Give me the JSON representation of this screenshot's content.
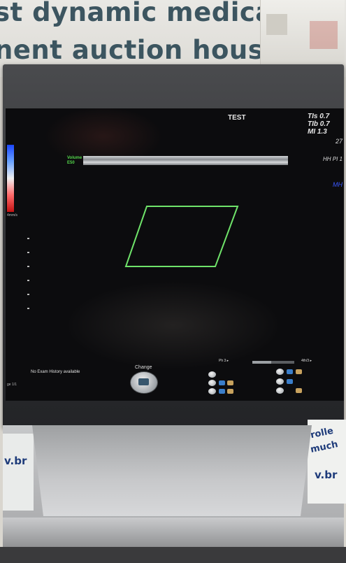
{
  "banner": {
    "line1": "st dynamic medical",
    "line2": "nent auction house"
  },
  "screen": {
    "title": "TEST",
    "metrics": [
      "TIs 0.7",
      "TIb 0.7",
      "MI  1.3"
    ],
    "metric_value_right": "27",
    "side_label_1": "HH PI 1",
    "side_label_2": "MH",
    "volume_label": "Volume",
    "volume_sub": "E50",
    "no_history": "No Exam History available",
    "change_label": "Change",
    "gauge_left": "Ph 3 ▸",
    "gauge_right": "4th/3 ▸",
    "page_label": "ge 1/1",
    "roi_color": "#6fe36a",
    "colorbar_label": "4mm/s"
  },
  "stand": {
    "left_text": "v.br",
    "right_text_1": "rolle",
    "right_text_2": "much",
    "right_text_3": "v.br"
  }
}
